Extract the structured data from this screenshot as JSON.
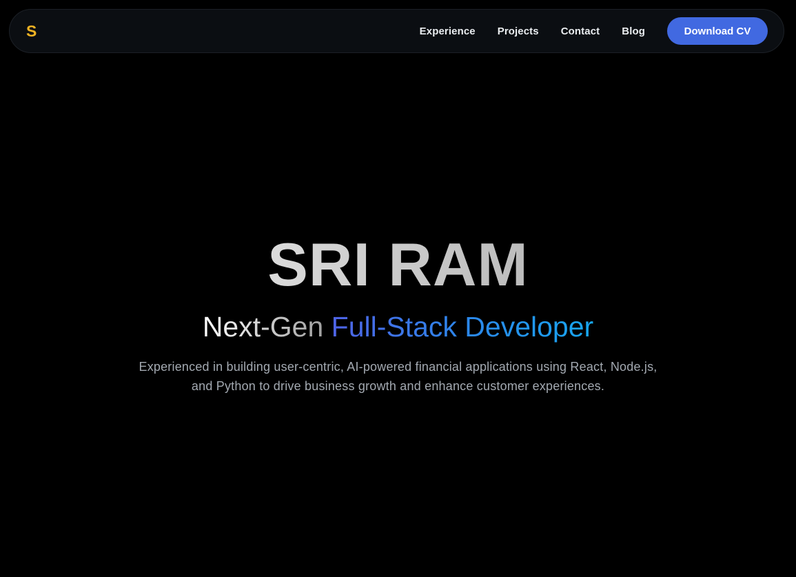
{
  "nav": {
    "logo": "S",
    "links": [
      {
        "label": "Experience"
      },
      {
        "label": "Projects"
      },
      {
        "label": "Contact"
      },
      {
        "label": "Blog"
      }
    ],
    "cta_label": "Download CV"
  },
  "hero": {
    "name": "SRI RAM",
    "role_part1": "Next-Gen ",
    "role_part2": "Full-Stack Developer",
    "description": "Experienced in building user-centric, AI-powered financial applications using React, Node.js, and Python to drive business growth and enhance customer experiences."
  },
  "colors": {
    "background": "#000000",
    "nav_background": "#0b0e12",
    "logo": "#f0b323",
    "cta_background": "#4169e1",
    "accent_blue": "#2c86ea",
    "description_text": "#a3a9b1"
  }
}
